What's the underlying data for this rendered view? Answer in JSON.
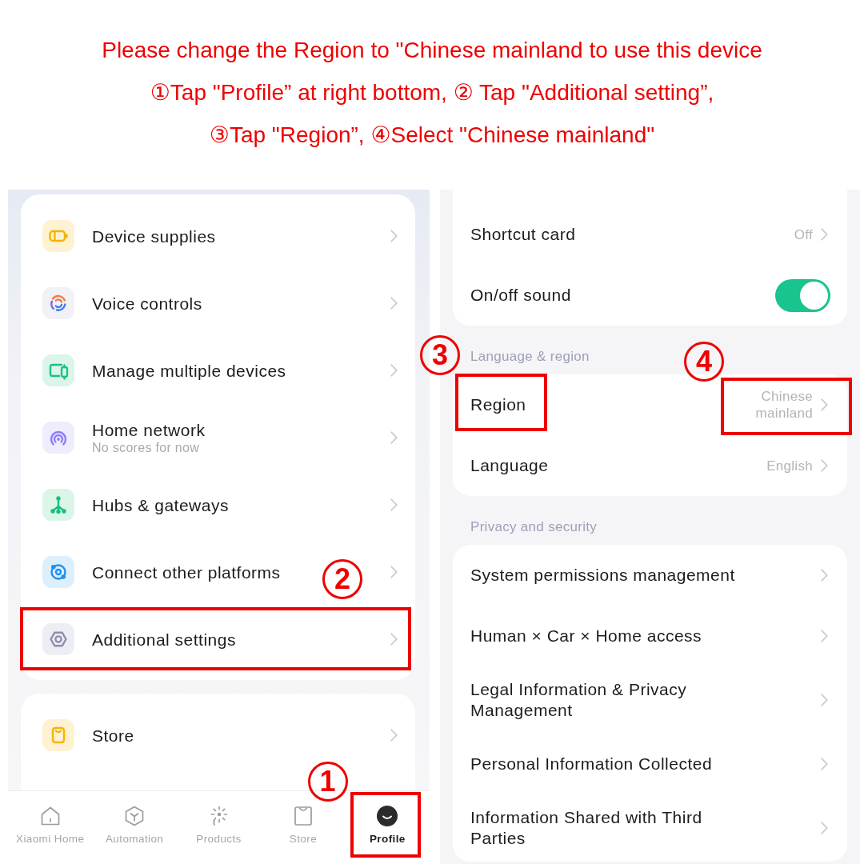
{
  "instructions": [
    "Please change the Region to \"Chinese mainland to use this device",
    "①Tap \"Profile” at right bottom, ② Tap \"Additional setting”,",
    "③Tap \"Region”, ④Select \"Chinese mainland\""
  ],
  "left_screen": {
    "cards": [
      {
        "items": [
          {
            "label": "Device supplies"
          },
          {
            "label": "Voice controls"
          },
          {
            "label": "Manage multiple devices"
          },
          {
            "label": "Home network",
            "subtitle": "No scores for now"
          },
          {
            "label": "Hubs & gateways"
          },
          {
            "label": "Connect other platforms"
          },
          {
            "label": "Additional settings",
            "step": "2"
          }
        ]
      },
      {
        "items": [
          {
            "label": "Store"
          }
        ]
      }
    ],
    "tab_bar": [
      {
        "label": "Xiaomi Home",
        "selected": false
      },
      {
        "label": "Automation",
        "selected": false
      },
      {
        "label": "Products",
        "selected": false
      },
      {
        "label": "Store",
        "selected": false
      },
      {
        "label": "Profile",
        "selected": true,
        "step": "1"
      }
    ]
  },
  "right_screen": {
    "sections": [
      {
        "rows": [
          {
            "kind": "value",
            "label": "Shortcut card",
            "value": "Off"
          },
          {
            "kind": "toggle",
            "label": "On/off sound",
            "on": true
          }
        ]
      },
      {
        "title": "Language & region",
        "rows": [
          {
            "kind": "value",
            "label": "Region",
            "label_step": "3",
            "value": "Chinese mainland",
            "value_step": "4"
          },
          {
            "kind": "value",
            "label": "Language",
            "value": "English"
          }
        ]
      },
      {
        "title": "Privacy and security",
        "rows": [
          {
            "kind": "link",
            "label": "System permissions management"
          },
          {
            "kind": "link",
            "label": "Human × Car × Home access"
          },
          {
            "kind": "link",
            "label": "Legal Information & Privacy Management"
          },
          {
            "kind": "link",
            "label": "Personal Information Collected"
          },
          {
            "kind": "link",
            "label": "Information Shared with Third Parties"
          }
        ]
      }
    ]
  }
}
